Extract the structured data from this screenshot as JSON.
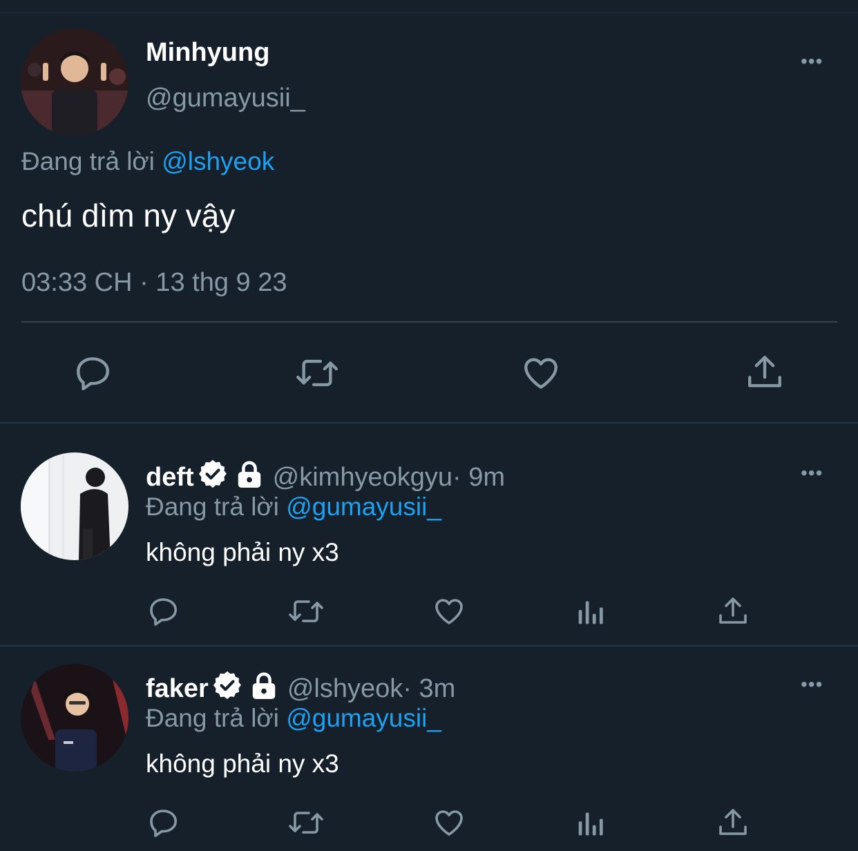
{
  "main_tweet": {
    "name": "Minhyung",
    "handle": "@gumayusii_",
    "replying_prefix": "Đang trả lời",
    "replying_to": "@lshyeok",
    "text": "chú dìm ny vậy",
    "timestamp": "03:33 CH · 13 thg 9 23",
    "more_label": "•••",
    "actions": [
      "reply-icon",
      "retweet-icon",
      "like-icon",
      "share-icon"
    ]
  },
  "replies": [
    {
      "name": "deft",
      "handle": "@kimhyeokgyu",
      "time": " · 9m",
      "replying_prefix": "Đang trả lời",
      "replying_to": "@gumayusii_",
      "text": "không phải ny x3",
      "verified": true,
      "protected": true,
      "more_label": "•••",
      "actions": [
        "reply-icon",
        "retweet-icon",
        "like-icon",
        "analytics-icon",
        "share-icon"
      ]
    },
    {
      "name": "faker",
      "handle": "@lshyeok",
      "time": " · 3m",
      "replying_prefix": "Đang trả lời",
      "replying_to": "@gumayusii_",
      "text": "không phải ny x3",
      "verified": true,
      "protected": true,
      "more_label": "•••",
      "actions": [
        "reply-icon",
        "retweet-icon",
        "like-icon",
        "analytics-icon",
        "share-icon"
      ]
    }
  ],
  "colors": {
    "background": "#15202b",
    "secondary_text": "#8899a6",
    "link": "#1da1f2",
    "divider": "#38444d"
  }
}
